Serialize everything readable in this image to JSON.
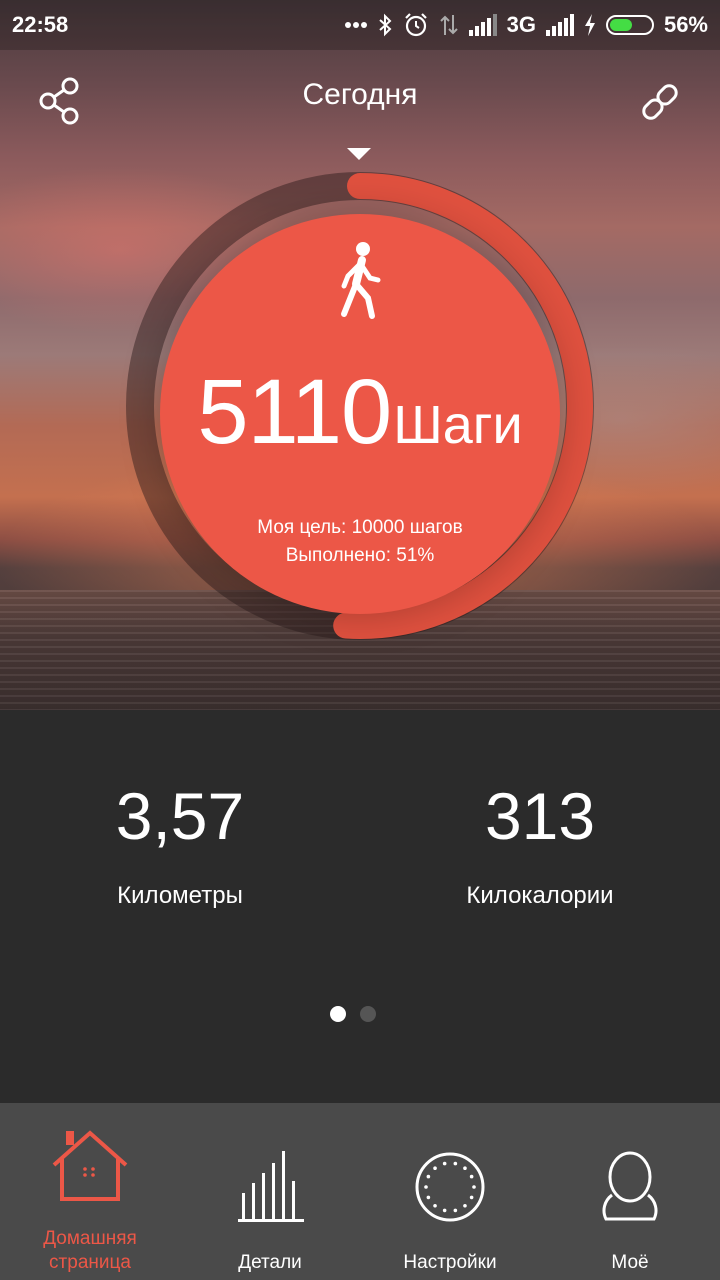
{
  "status_bar": {
    "time": "22:58",
    "network": "3G",
    "battery_percent": "56%",
    "battery_level": 0.56
  },
  "header": {
    "title": "Сегодня"
  },
  "activity": {
    "steps": "5110",
    "steps_unit": "Шаги",
    "goal_text": "Моя цель: 10000 шагов",
    "progress_text": "Выполнено: 51%",
    "progress_fraction": 0.51,
    "accent_color": "#ec5747"
  },
  "stats": {
    "distance_value": "3,57",
    "distance_label": "Километры",
    "calories_value": "313",
    "calories_label": "Килокалории"
  },
  "pager": {
    "pages": 2,
    "active_index": 0
  },
  "nav": {
    "items": [
      {
        "label_line1": "Домашняя",
        "label_line2": "страница",
        "icon": "home-icon",
        "active": true
      },
      {
        "label": "Детали",
        "icon": "bar-chart-icon"
      },
      {
        "label": "Настройки",
        "icon": "device-ring-icon"
      },
      {
        "label": "Моё",
        "icon": "profile-icon"
      }
    ]
  }
}
